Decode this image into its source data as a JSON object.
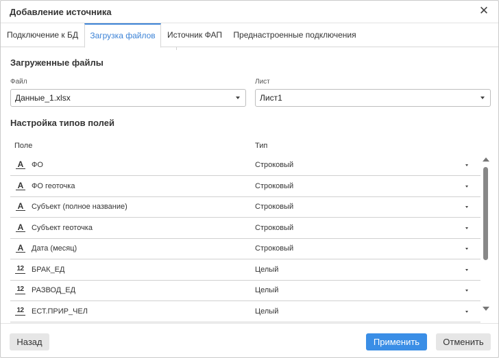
{
  "dialog": {
    "title": "Добавление источника"
  },
  "tabs": [
    {
      "label": "Подключение к БД"
    },
    {
      "label": "Загрузка файлов"
    },
    {
      "label": "Источник ФАП"
    },
    {
      "label": "Преднастроенные подключения"
    }
  ],
  "active_tab": "Загрузка файлов",
  "uploaded": {
    "section_title": "Загруженные файлы",
    "file_label": "Файл",
    "file_value": "Данные_1.xlsx",
    "sheet_label": "Лист",
    "sheet_value": "Лист1"
  },
  "field_types": {
    "section_title": "Настройка типов полей",
    "col_field": "Поле",
    "col_type": "Тип",
    "rows": [
      {
        "icon": "A",
        "icon_name": "text-type-icon",
        "name": "ФО",
        "type": "Строковый"
      },
      {
        "icon": "A",
        "icon_name": "text-type-icon",
        "name": "ФО геоточка",
        "type": "Строковый"
      },
      {
        "icon": "A",
        "icon_name": "text-type-icon",
        "name": "Субъект (полное название)",
        "type": "Строковый"
      },
      {
        "icon": "A",
        "icon_name": "text-type-icon",
        "name": "Субъект геоточка",
        "type": "Строковый"
      },
      {
        "icon": "A",
        "icon_name": "text-type-icon",
        "name": "Дата (месяц)",
        "type": "Строковый"
      },
      {
        "icon": "12",
        "icon_name": "number-type-icon",
        "name": "БРАК_ЕД",
        "type": "Целый"
      },
      {
        "icon": "12",
        "icon_name": "number-type-icon",
        "name": "РАЗВОД_ЕД",
        "type": "Целый"
      },
      {
        "icon": "12",
        "icon_name": "number-type-icon",
        "name": "ЕСТ.ПРИР_ЧЕЛ",
        "type": "Целый"
      }
    ]
  },
  "footer": {
    "back_label": "Назад",
    "apply_label": "Применить",
    "cancel_label": "Отменить"
  },
  "colors": {
    "accent": "#3a8ee6",
    "active_tab_text": "#3b82d6"
  }
}
